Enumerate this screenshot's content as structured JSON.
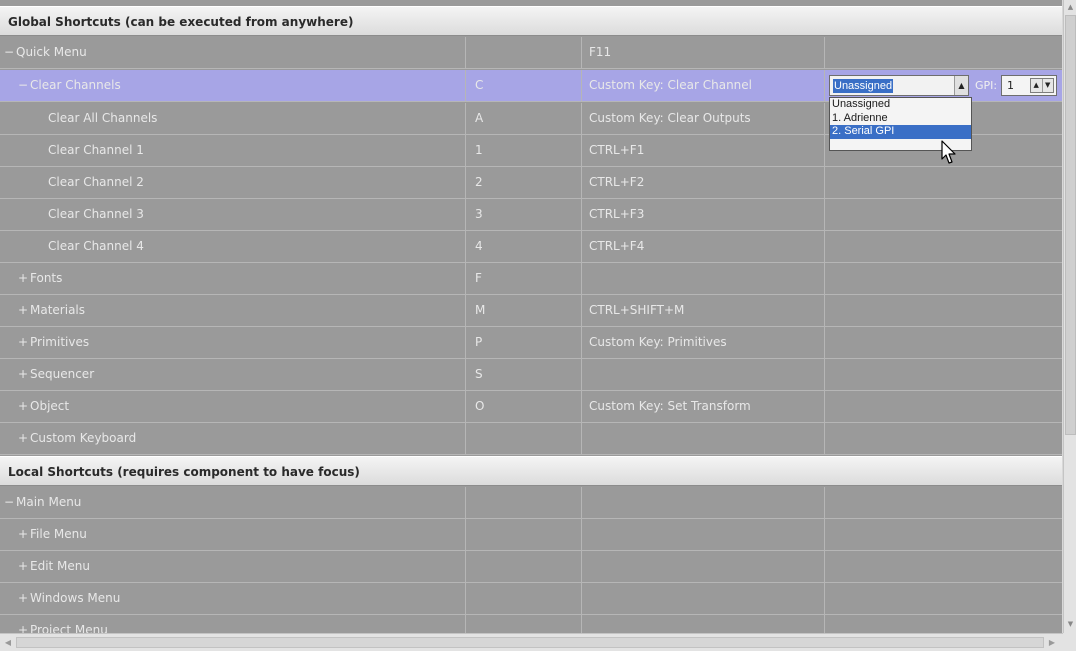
{
  "sections": {
    "global_title": "Global Shortcuts (can be executed from anywhere)",
    "local_title": "Local Shortcuts (requires component to have focus)"
  },
  "rows": {
    "quick_menu": {
      "exp": "−",
      "name": "Quick Menu",
      "key": "",
      "action": "F11"
    },
    "clear_channels": {
      "exp": "−",
      "name": "Clear Channels",
      "key": "C",
      "action": "Custom Key: Clear Channel"
    },
    "clear_all": {
      "name": "Clear All Channels",
      "key": "A",
      "action": "Custom Key: Clear Outputs"
    },
    "clear_1": {
      "name": "Clear Channel 1",
      "key": "1",
      "action": "CTRL+F1"
    },
    "clear_2": {
      "name": "Clear Channel 2",
      "key": "2",
      "action": "CTRL+F2"
    },
    "clear_3": {
      "name": "Clear Channel 3",
      "key": "3",
      "action": "CTRL+F3"
    },
    "clear_4": {
      "name": "Clear Channel 4",
      "key": "4",
      "action": "CTRL+F4"
    },
    "fonts": {
      "exp": "+",
      "name": "Fonts",
      "key": "F",
      "action": ""
    },
    "materials": {
      "exp": "+",
      "name": "Materials",
      "key": "M",
      "action": "CTRL+SHIFT+M"
    },
    "primitives": {
      "exp": "+",
      "name": "Primitives",
      "key": "P",
      "action": "Custom Key: Primitives"
    },
    "sequencer": {
      "exp": "+",
      "name": "Sequencer",
      "key": "S",
      "action": ""
    },
    "object": {
      "exp": "+",
      "name": "Object",
      "key": "O",
      "action": "Custom Key: Set Transform"
    },
    "custom_keyboard": {
      "exp": "+",
      "name": "Custom Keyboard",
      "key": "",
      "action": ""
    },
    "main_menu": {
      "exp": "−",
      "name": "Main Menu"
    },
    "file_menu": {
      "exp": "+",
      "name": "File Menu"
    },
    "edit_menu": {
      "exp": "+",
      "name": "Edit Menu"
    },
    "windows_menu": {
      "exp": "+",
      "name": "Windows Menu"
    },
    "project_menu": {
      "exp": "+",
      "name": "Project Menu"
    }
  },
  "gpi": {
    "selected": "Unassigned",
    "label": "GPI:",
    "value": "1",
    "options": [
      "Unassigned",
      "1. Adrienne",
      "2. Serial GPI"
    ],
    "highlighted_index": 2
  },
  "colors": {
    "row_bg": "#9a9a9a",
    "selected_row_bg": "#a7a5e6",
    "highlight": "#3a6fc6"
  }
}
